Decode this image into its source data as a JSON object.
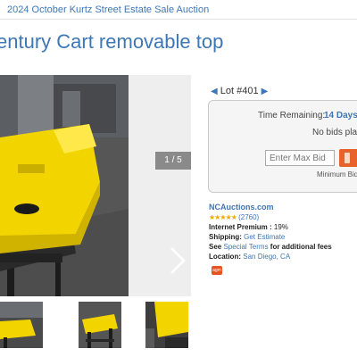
{
  "breadcrumb": "2024 October Kurtz Street Estate Sale Auction",
  "title": "entury Cart removable top",
  "gallery": {
    "counter": "1 / 5",
    "icons": {
      "next": "chevron-right-icon",
      "expand": "expand-icon"
    },
    "thumbnails": [
      "thumbnail-1",
      "thumbnail-2",
      "thumbnail-3"
    ]
  },
  "lot": {
    "prev_icon": "arrow-left-icon",
    "label": "Lot #401",
    "next_icon": "arrow-right-icon"
  },
  "bidding": {
    "time_remaining_label": "Time Remaining:",
    "time_remaining_value": "14 Days",
    "no_bids_text": "No bids plac",
    "max_bid_placeholder": "Enter Max Bid",
    "minimum_bid_label": "Minimum Bid:"
  },
  "seller": {
    "name": "NCAuctions.com",
    "stars": "★★★★★",
    "rating_count": "(2760)",
    "internet_premium_label": "Internet Premium :",
    "internet_premium_value": " 19%",
    "shipping_label": "Shipping:",
    "shipping_link": "Get Estimate",
    "terms_prefix": "See ",
    "terms_link": "Special Terms",
    "terms_suffix": " for additional fees",
    "location_label": "Location:",
    "location_value": "San Diego, CA",
    "badge_text": "agm"
  },
  "colors": {
    "link_blue": "#3d77b6",
    "bid_orange": "#e8632b",
    "star_gold": "#f0a800",
    "cart_yellow": "#f2d400"
  }
}
